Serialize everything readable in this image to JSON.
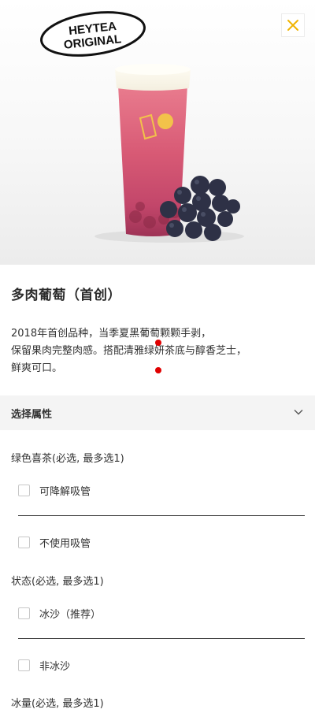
{
  "brand": {
    "logo_text_line1": "HEYTEA",
    "logo_text_line2": "ORIGINAL"
  },
  "product": {
    "name": "多肉葡萄（首创）",
    "description_lines": [
      "2018年首创品种，当季夏黑葡萄颗颗手剥，",
      "保留果肉完整肉感。搭配清雅绿妍茶底与醇香芝士，",
      "鲜爽可口。"
    ]
  },
  "attributes": {
    "header": "选择属性",
    "groups": [
      {
        "title": "绿色喜茶(必选, 最多选1)",
        "options": [
          "可降解吸管",
          "不使用吸管"
        ]
      },
      {
        "title": "状态(必选, 最多选1)",
        "options": [
          "冰沙（推荐）",
          "非冰沙"
        ]
      },
      {
        "title": "冰量(必选, 最多选1)",
        "options": []
      }
    ]
  },
  "colors": {
    "accent": "#f0b400",
    "marker": "#e00000",
    "panel": "#f4f4f4"
  },
  "icons": {
    "close": "close-icon",
    "chevron": "chevron-down-icon"
  }
}
